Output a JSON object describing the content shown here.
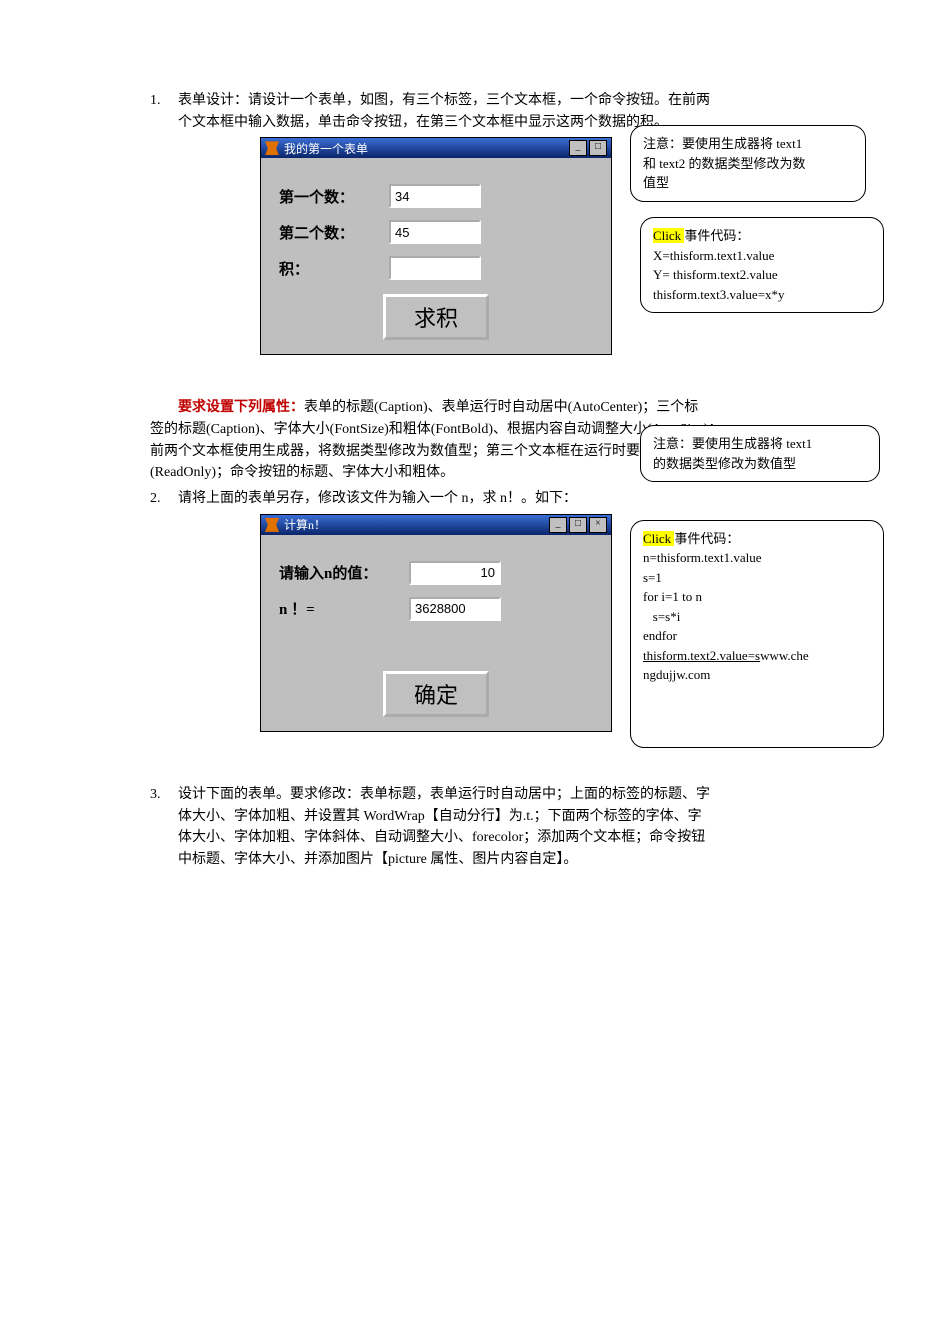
{
  "q1": {
    "num": "1.",
    "line1": "表单设计：请设计一个表单，如图，有三个标签，三个文本框，一个命令按钮。在前两",
    "line2": "个文本框中输入数据，单击命令按钮，在第三个文本框中显示这两个数据的积。"
  },
  "form1": {
    "title": "我的第一个表单",
    "lab1": "第一个数：",
    "val1": "34",
    "lab2": "第二个数：",
    "val2": "45",
    "lab3": "积：",
    "val3": "",
    "btn": "求积",
    "min": "_",
    "sq": "□"
  },
  "call1": {
    "l1": "注意：要使用生成器将 text1",
    "l2": "和 text2 的数据类型修改为数",
    "l3": "值型"
  },
  "call2": {
    "head": "Click ",
    "tail": "事件代码：",
    "l1": "X=thisform.text1.value",
    "l2": "Y=  thisform.text2.value",
    "l3": "thisform.text3.value=x*y"
  },
  "reqhead": "要求设置下列属性：",
  "reqbody1": "表单的标题(Caption)、表单运行时自动居中(AutoCenter)；三个标",
  "reqbody2": "签的标题(Caption)、字体大小(FontSize)和粗体(FontBold)、根据内容自动调整大小(AutoSize)；",
  "reqbody3": "前两个文本框使用生成器，将数据类型修改为数值型；第三个文本框在运行时要只读",
  "reqbody4": "(ReadOnly)；命令按钮的标题、字体大小和粗体。",
  "call2b": {
    "l1": "注意：要使用生成器将 text1",
    "l2": "的数据类型修改为数值型"
  },
  "q2": {
    "num": "2.",
    "text": "请将上面的表单另存，修改该文件为输入一个 n，求 n！。如下："
  },
  "form2": {
    "title": "计算n！",
    "lab1": "请输入n的值：",
    "val1": "10",
    "lab2": "n ！=",
    "val2": "3628800",
    "btn": "确定",
    "min": "_",
    "sq": "□",
    "x": "×"
  },
  "call3": {
    "head": "Click ",
    "tail": "事件代码：",
    "l1": "n=thisform.text1.value",
    "l2": "s=1",
    "l3": "for i=1 to n",
    "l4": "   s=s*i",
    "l5": "endfor",
    "l6": "thisform.text2.value=s",
    "l7": "ngdujjw.com",
    "l6b": "www.che"
  },
  "q3": {
    "num": "3.",
    "l1": "设计下面的表单。要求修改：表单标题，表单运行时自动居中；上面的标签的标题、字",
    "l2": "体大小、字体加粗、并设置其 WordWrap【自动分行】为.t.；下面两个标签的字体、字",
    "l3": "体大小、字体加粗、字体斜体、自动调整大小、forecolor；添加两个文本框；命令按钮",
    "l4": "中标题、字体大小、并添加图片【picture 属性、图片内容自定】。"
  }
}
